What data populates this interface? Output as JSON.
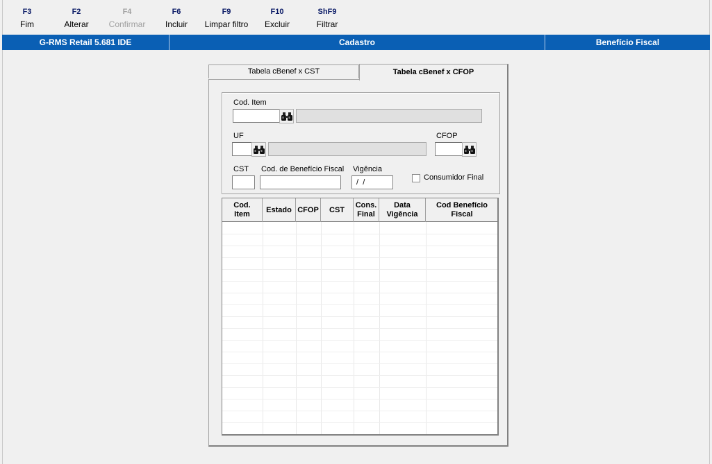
{
  "toolbar": {
    "items": [
      {
        "key": "F3",
        "label": "Fim",
        "enabled": true
      },
      {
        "key": "F2",
        "label": "Alterar",
        "enabled": true
      },
      {
        "key": "F4",
        "label": "Confirmar",
        "enabled": false
      },
      {
        "key": "F6",
        "label": "Incluir",
        "enabled": true
      },
      {
        "key": "F9",
        "label": "Limpar filtro",
        "enabled": true
      },
      {
        "key": "F10",
        "label": "Excluir",
        "enabled": true
      },
      {
        "key": "ShF9",
        "label": "Filtrar",
        "enabled": true
      }
    ]
  },
  "statusbar": {
    "app": "G-RMS Retail 5.681 IDE",
    "module": "Cadastro",
    "screen": "Benefício Fiscal",
    "color": "#0a5fb4"
  },
  "tabs": [
    {
      "label": "Tabela cBenef x CST",
      "active": false
    },
    {
      "label": "Tabela cBenef x CFOP",
      "active": true
    }
  ],
  "form": {
    "cod_item_label": "Cod. Item",
    "cod_item_value": "",
    "uf_label": "UF",
    "uf_value": "",
    "cfop_label": "CFOP",
    "cfop_value": "",
    "cst_label": "CST",
    "cst_value": "",
    "cod_beneficio_label": "Cod. de Benefício Fiscal",
    "cod_beneficio_value": "",
    "vigencia_label": "Vigência",
    "vigencia_value": " /  / ",
    "consumidor_final_label": "Consumidor Final",
    "consumidor_final_checked": false
  },
  "grid": {
    "columns": [
      "Cod.\nItem",
      "Estado",
      "CFOP",
      "CST",
      "Cons.\nFinal",
      "Data\nVigência",
      "Cod Benefício\nFiscal"
    ],
    "rows": []
  },
  "icons": {
    "find": "binoculars-icon"
  }
}
